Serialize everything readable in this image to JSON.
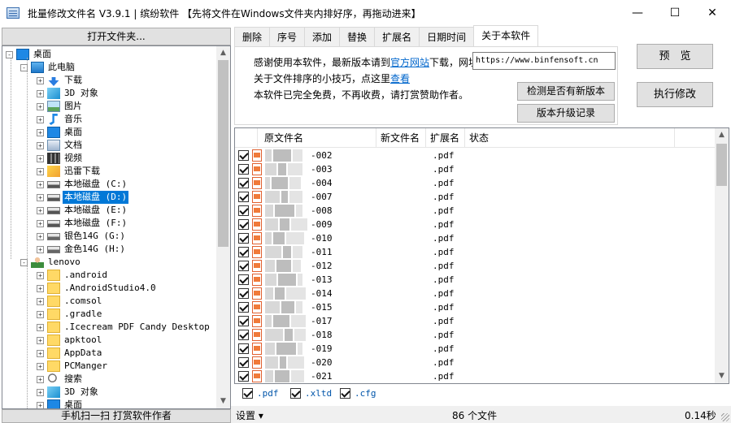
{
  "window": {
    "title": "批量修改文件名 V3.9.1 | 缤纷软件  【先将文件在Windows文件夹内排好序，再拖动进来】",
    "minimize": "—",
    "maximize": "☐",
    "close": "✕"
  },
  "left": {
    "open_folder": "打开文件夹...",
    "scan_button": "手机扫一扫 打赏软件作者",
    "tree": [
      {
        "label": "桌面",
        "icon": "desktop-icon",
        "level": 0,
        "expander": "-"
      },
      {
        "label": "此电脑",
        "icon": "computer-icon",
        "level": 1,
        "expander": "-"
      },
      {
        "label": "下载",
        "icon": "download-icon",
        "level": 2,
        "expander": "+"
      },
      {
        "label": "3D 对象",
        "icon": "3d-objects-icon",
        "level": 2,
        "expander": "+"
      },
      {
        "label": "图片",
        "icon": "pictures-icon",
        "level": 2,
        "expander": "+"
      },
      {
        "label": "音乐",
        "icon": "music-icon",
        "level": 2,
        "expander": "+"
      },
      {
        "label": "桌面",
        "icon": "desktop-icon",
        "level": 2,
        "expander": "+"
      },
      {
        "label": "文档",
        "icon": "documents-icon",
        "level": 2,
        "expander": "+"
      },
      {
        "label": "视频",
        "icon": "video-icon",
        "level": 2,
        "expander": "+"
      },
      {
        "label": "迅雷下载",
        "icon": "thunder-icon",
        "level": 2,
        "expander": "+"
      },
      {
        "label": "本地磁盘 (C:)",
        "icon": "drive-icon",
        "level": 2,
        "expander": "+"
      },
      {
        "label": "本地磁盘 (D:)",
        "icon": "drive-icon",
        "level": 2,
        "expander": "+",
        "selected": true
      },
      {
        "label": "本地磁盘 (E:)",
        "icon": "drive-icon",
        "level": 2,
        "expander": "+"
      },
      {
        "label": "本地磁盘 (F:)",
        "icon": "drive-icon",
        "level": 2,
        "expander": "+"
      },
      {
        "label": "银色14G (G:)",
        "icon": "usb-drive-icon",
        "level": 2,
        "expander": "+"
      },
      {
        "label": "金色14G (H:)",
        "icon": "usb-drive-icon",
        "level": 2,
        "expander": "+"
      },
      {
        "label": "lenovo",
        "icon": "user-icon",
        "level": 1,
        "expander": "-"
      },
      {
        "label": ".android",
        "icon": "folder-icon",
        "level": 2,
        "expander": "+"
      },
      {
        "label": ".AndroidStudio4.0",
        "icon": "folder-icon",
        "level": 2,
        "expander": "+"
      },
      {
        "label": ".comsol",
        "icon": "folder-icon",
        "level": 2,
        "expander": "+"
      },
      {
        "label": ".gradle",
        "icon": "folder-icon",
        "level": 2,
        "expander": "+"
      },
      {
        "label": ".Icecream PDF Candy Desktop",
        "icon": "folder-icon",
        "level": 2,
        "expander": "+"
      },
      {
        "label": "apktool",
        "icon": "folder-icon",
        "level": 2,
        "expander": "+"
      },
      {
        "label": "AppData",
        "icon": "folder-icon",
        "level": 2,
        "expander": "+"
      },
      {
        "label": "PCManger",
        "icon": "folder-icon",
        "level": 2,
        "expander": "+"
      },
      {
        "label": "搜索",
        "icon": "search-icon",
        "level": 2,
        "expander": "+"
      },
      {
        "label": "3D 对象",
        "icon": "3d-objects-icon",
        "level": 2,
        "expander": "+"
      },
      {
        "label": "桌面",
        "icon": "desktop-icon",
        "level": 2,
        "expander": "+"
      }
    ]
  },
  "tabs": [
    "删除",
    "序号",
    "添加",
    "替换",
    "扩展名",
    "日期时间",
    "关于本软件"
  ],
  "about": {
    "line1_a": "感谢使用本软件，最新版本请到",
    "line1_link": "官方网站",
    "line1_b": "下载，网址",
    "url": "https://www.binfensoft.cn",
    "line2_a": "关于文件排序的小技巧，点这里",
    "line2_link": "查看",
    "line3": "本软件已完全免费，不再收费，请打赏赞助作者。",
    "check_update": "检测是否有新版本",
    "changelog": "版本升级记录"
  },
  "actions": {
    "preview": "预　览",
    "execute": "执行修改"
  },
  "list": {
    "columns": [
      "原文件名",
      "新文件名",
      "扩展名",
      "状态"
    ],
    "rows": [
      {
        "suffix": "-002",
        "ext": ".pdf"
      },
      {
        "suffix": "-003",
        "ext": ".pdf"
      },
      {
        "suffix": "-004",
        "ext": ".pdf"
      },
      {
        "suffix": "-007",
        "ext": ".pdf"
      },
      {
        "suffix": "-008",
        "ext": ".pdf"
      },
      {
        "suffix": "-009",
        "ext": ".pdf"
      },
      {
        "suffix": "-010",
        "ext": ".pdf"
      },
      {
        "suffix": "-011",
        "ext": ".pdf"
      },
      {
        "suffix": "-012",
        "ext": ".pdf"
      },
      {
        "suffix": "-013",
        "ext": ".pdf"
      },
      {
        "suffix": "-014",
        "ext": ".pdf"
      },
      {
        "suffix": "-015",
        "ext": ".pdf"
      },
      {
        "suffix": "-017",
        "ext": ".pdf"
      },
      {
        "suffix": "-018",
        "ext": ".pdf"
      },
      {
        "suffix": "-019",
        "ext": ".pdf"
      },
      {
        "suffix": "-020",
        "ext": ".pdf"
      },
      {
        "suffix": "-021",
        "ext": ".pdf"
      }
    ]
  },
  "filters": [
    ".pdf",
    ".xltd",
    ".cfg"
  ],
  "status": {
    "settings": "设置 ▾",
    "count": "86 个文件",
    "time": "0.14秒"
  },
  "colors": {
    "accent": "#0078d7",
    "link": "#0066cc",
    "filter_text": "#0055aa"
  }
}
